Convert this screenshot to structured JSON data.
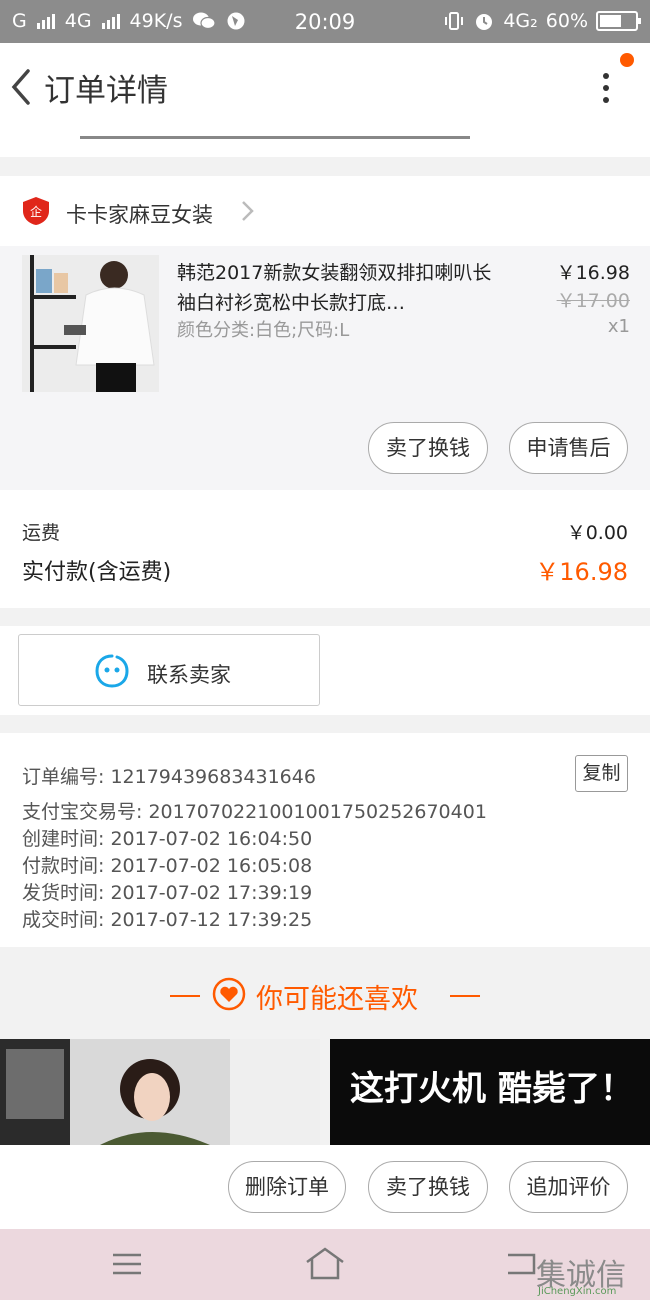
{
  "status_bar": {
    "carrier_1": "G",
    "carrier_2": "4G",
    "speed": "49K/s",
    "time": "20:09",
    "carrier_3": "4G₂",
    "battery": "60%"
  },
  "header": {
    "title": "订单详情",
    "back_icon": "chevron-left-icon",
    "more_icon": "more-vertical-icon",
    "accent": "#ff5a00"
  },
  "shop": {
    "name": "卡卡家麻豆女装"
  },
  "item": {
    "name": "韩范2017新款女装翻领双排扣喇叭长袖白衬衫宽松中长款打底…",
    "spec": "颜色分类:白色;尺码:L",
    "price": "￥16.98",
    "original_price": "￥17.00",
    "qty": "x1",
    "buttons": {
      "sell": "卖了换钱",
      "after_sale": "申请售后"
    }
  },
  "fees": {
    "shipping_label": "运费",
    "shipping_value": "￥0.00",
    "paid_label": "实付款(含运费)",
    "paid_value": "￥16.98",
    "paid_color": "#ff5a00"
  },
  "contact": {
    "label": "联系卖家"
  },
  "order_info": {
    "order_no": "订单编号: 12179439683431646",
    "alipay_no": "支付宝交易号: 2017070221001001750252670401",
    "created": "创建时间: 2017-07-02  16:04:50",
    "paid": "付款时间: 2017-07-02  16:05:08",
    "shipped": "发货时间: 2017-07-02  17:39:19",
    "completed": "成交时间: 2017-07-12  17:39:25",
    "copy_label": "复制"
  },
  "recommend": {
    "title": "你可能还喜欢",
    "right_banner_text": "这打火机  酷毙了！"
  },
  "bottom_actions": {
    "delete": "删除订单",
    "sell": "卖了换钱",
    "review": "追加评价"
  },
  "watermark": {
    "text": "集诚信",
    "sub": "JiChengXin.com"
  }
}
